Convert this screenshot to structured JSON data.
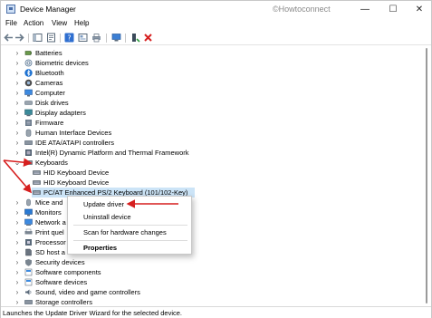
{
  "window": {
    "title": "Device Manager",
    "watermark": "©Howtoconnect"
  },
  "controls": {
    "minimize": "—",
    "maximize": "☐",
    "close": "✕"
  },
  "menu": [
    "File",
    "Action",
    "View",
    "Help"
  ],
  "tree": [
    {
      "label": "Batteries",
      "icon": "battery-icon"
    },
    {
      "label": "Biometric devices",
      "icon": "biometric-icon"
    },
    {
      "label": "Bluetooth",
      "icon": "bluetooth-icon"
    },
    {
      "label": "Cameras",
      "icon": "camera-icon"
    },
    {
      "label": "Computer",
      "icon": "computer-icon"
    },
    {
      "label": "Disk drives",
      "icon": "disk-icon"
    },
    {
      "label": "Display adapters",
      "icon": "display-icon"
    },
    {
      "label": "Firmware",
      "icon": "firmware-icon"
    },
    {
      "label": "Human Interface Devices",
      "icon": "hid-icon"
    },
    {
      "label": "IDE ATA/ATAPI controllers",
      "icon": "ide-icon"
    },
    {
      "label": "Intel(R) Dynamic Platform and Thermal Framework",
      "icon": "intel-icon"
    },
    {
      "label": "Keyboards",
      "icon": "keyboard-icon",
      "expanded": true
    },
    {
      "label": "HID Keyboard Device",
      "icon": "keyboard-icon",
      "child": true
    },
    {
      "label": "HID Keyboard Device",
      "icon": "keyboard-icon",
      "child": true
    },
    {
      "label": "PC/AT Enhanced PS/2 Keyboard (101/102-Key)",
      "icon": "keyboard-icon",
      "child": true,
      "selected": true
    },
    {
      "label": "Mice and",
      "icon": "mouse-icon"
    },
    {
      "label": "Monitors",
      "icon": "monitor-icon"
    },
    {
      "label": "Network a",
      "icon": "network-icon"
    },
    {
      "label": "Print quel",
      "icon": "printer-icon"
    },
    {
      "label": "Processor",
      "icon": "processor-icon"
    },
    {
      "label": "SD host a",
      "icon": "sd-icon"
    },
    {
      "label": "Security devices",
      "icon": "security-icon"
    },
    {
      "label": "Software components",
      "icon": "software-icon"
    },
    {
      "label": "Software devices",
      "icon": "software-icon"
    },
    {
      "label": "Sound, video and game controllers",
      "icon": "sound-icon"
    },
    {
      "label": "Storage controllers",
      "icon": "storage-icon"
    }
  ],
  "context_menu": {
    "update": "Update driver",
    "uninstall": "Uninstall device",
    "scan": "Scan for hardware changes",
    "properties": "Properties"
  },
  "status": "Launches the Update Driver Wizard for the selected device.",
  "colors": {
    "arrow": "#d61f1f",
    "selection": "#cce4f7",
    "accent": "#1a73c8"
  }
}
